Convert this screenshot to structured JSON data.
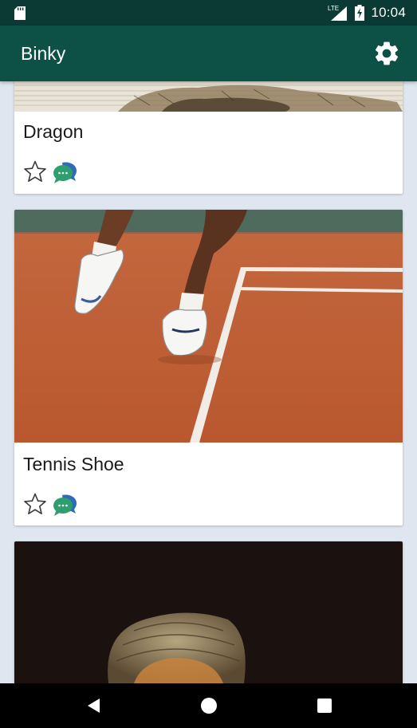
{
  "status_bar": {
    "time": "10:04",
    "network": "LTE",
    "icons": [
      "sd-card-icon",
      "signal-icon",
      "battery-charging-icon"
    ]
  },
  "app_bar": {
    "title": "Binky",
    "settings_icon": "gear-icon"
  },
  "feed": {
    "cards": [
      {
        "title": "Dragon",
        "favorite_icon": "star-outline-icon",
        "comment_icon": "chat-bubbles-icon"
      },
      {
        "title": "Tennis Shoe",
        "favorite_icon": "star-outline-icon",
        "comment_icon": "chat-bubbles-icon"
      },
      {
        "title": "",
        "favorite_icon": "",
        "comment_icon": ""
      }
    ]
  },
  "nav_bar": {
    "buttons": [
      "back-icon",
      "home-icon",
      "recents-icon"
    ]
  },
  "colors": {
    "status_bar": "#0a3a33",
    "app_bar": "#0d5046",
    "background": "#dfe6ef",
    "card": "#ffffff",
    "chat_icon_front": "#2e9e6e",
    "chat_icon_back": "#2d6db5"
  }
}
